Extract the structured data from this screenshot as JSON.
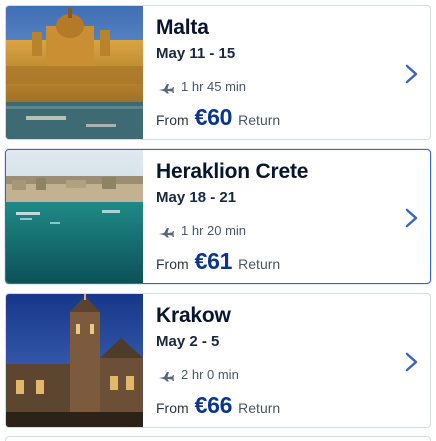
{
  "destinations": [
    {
      "city": "Malta",
      "dates": "May 11 - 15",
      "duration": "1 hr 45 min",
      "from_label": "From",
      "price": "€60",
      "trip_type": "Return",
      "image": "malta-church-harbor",
      "selected": false
    },
    {
      "city": "Heraklion Crete",
      "dates": "May 18 - 21",
      "duration": "1 hr 20 min",
      "from_label": "From",
      "price": "€61",
      "trip_type": "Return",
      "image": "heraklion-harbor",
      "selected": true
    },
    {
      "city": "Krakow",
      "dates": "May 2 - 5",
      "duration": "2 hr 0 min",
      "from_label": "From",
      "price": "€66",
      "trip_type": "Return",
      "image": "krakow-cathedral",
      "selected": false
    }
  ],
  "icons": {
    "flight": "plane-icon",
    "open": "chevron-right-icon"
  },
  "colors": {
    "price": "#073590",
    "chevron": "#3b64c5",
    "selected_border": "#3b64c5"
  }
}
